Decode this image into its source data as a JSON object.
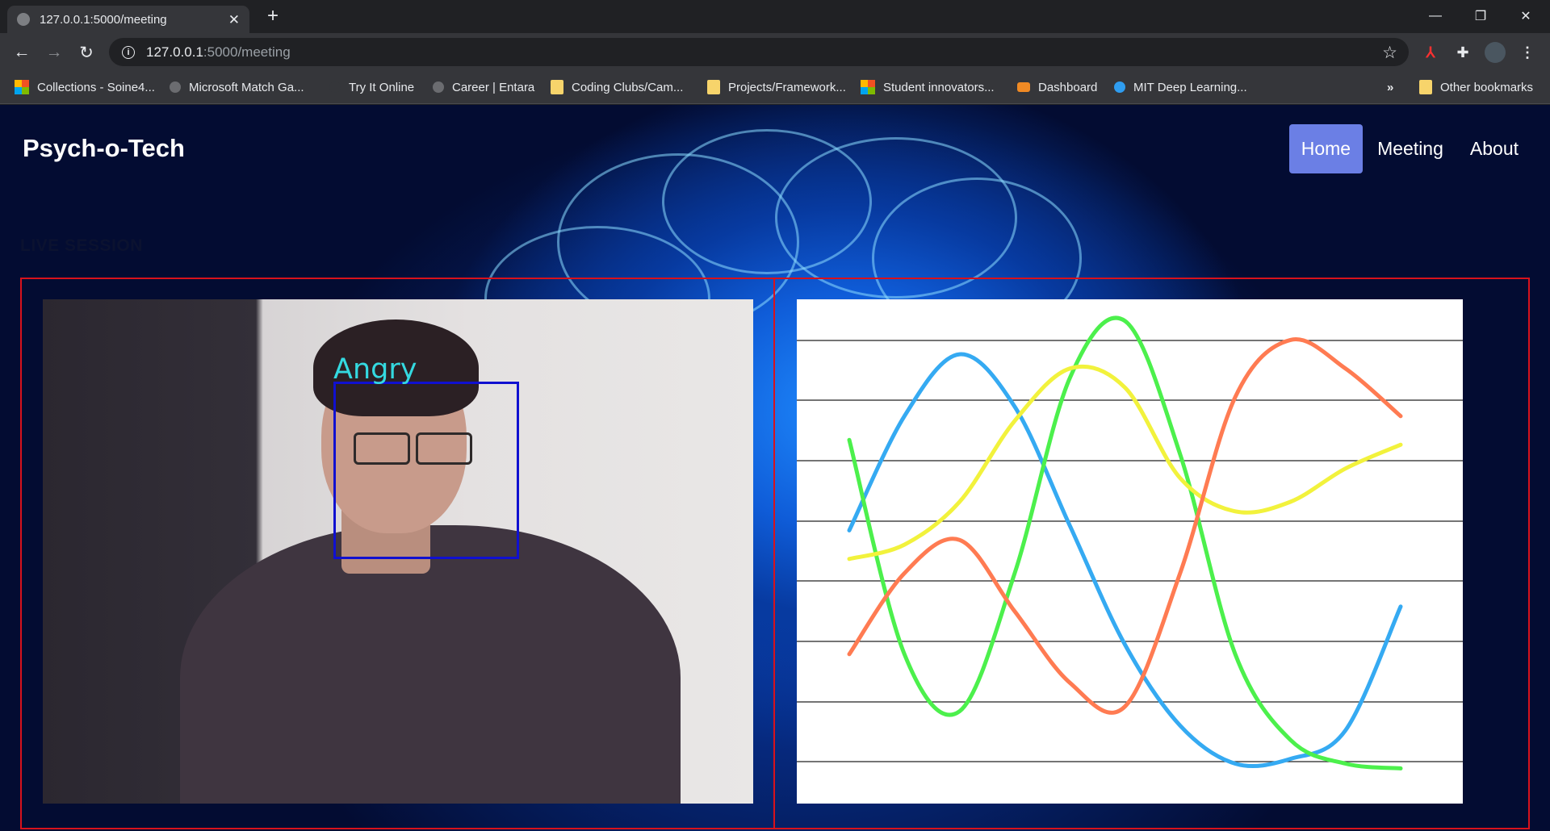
{
  "browser": {
    "tab_title": "127.0.0.1:5000/meeting",
    "url_host": "127.0.0.1",
    "url_path": ":5000/meeting",
    "bookmarks": [
      "Collections - Soine4...",
      "Microsoft Match Ga...",
      "Try It Online",
      "Career | Entara",
      "Coding Clubs/Cam...",
      "Projects/Framework...",
      "Student innovators...",
      "Dashboard",
      "MIT Deep Learning..."
    ],
    "bookmarks_overflow": "»",
    "other_bookmarks": "Other bookmarks"
  },
  "site": {
    "brand": "Psych-o-Tech",
    "nav": [
      "Home",
      "Meeting",
      "About"
    ],
    "active_nav": "Home",
    "section_title": "LIVE SESSION"
  },
  "webcam": {
    "emotion": "Angry",
    "box_color": "#1010d0",
    "label_color": "#34d9e0"
  },
  "chart_data": {
    "type": "line",
    "title": "",
    "xlabel": "",
    "ylabel": "",
    "grid": "horizontal",
    "x": [
      0,
      1,
      2,
      3,
      4,
      5,
      6,
      7,
      8,
      9,
      10
    ],
    "series": [
      {
        "color": "#35aaf2",
        "values": [
          0.54,
          0.78,
          0.91,
          0.8,
          0.55,
          0.3,
          0.13,
          0.05,
          0.06,
          0.12,
          0.38
        ]
      },
      {
        "color": "#4cf04c",
        "values": [
          0.73,
          0.28,
          0.16,
          0.45,
          0.86,
          0.98,
          0.7,
          0.28,
          0.1,
          0.05,
          0.04
        ]
      },
      {
        "color": "#f2f23c",
        "values": [
          0.48,
          0.51,
          0.6,
          0.77,
          0.88,
          0.84,
          0.65,
          0.58,
          0.6,
          0.67,
          0.72
        ]
      },
      {
        "color": "#ff7b52",
        "values": [
          0.28,
          0.45,
          0.52,
          0.37,
          0.22,
          0.17,
          0.45,
          0.82,
          0.94,
          0.88,
          0.78
        ]
      }
    ],
    "ylim": [
      0,
      1
    ]
  }
}
